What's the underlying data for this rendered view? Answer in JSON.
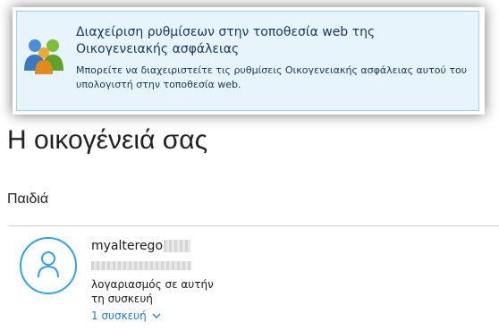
{
  "banner": {
    "title": "Διαχείριση ρυθμίσεων στην τοποθεσία web της Οικογενειακής ασφάλειας",
    "description": "Μπορείτε να διαχειριστείτε τις ρυθμίσεις Οικογενειακής ασφάλειας αυτού του υπολογιστή στην τοποθεσία web.",
    "icon": "family-users-icon"
  },
  "page": {
    "heading": "Η οικογένειά σας",
    "section_heading": "Παιδιά"
  },
  "child": {
    "name": "myalterego",
    "account_note": "λογαριασμός σε αυτήν τη συσκευή",
    "devices_label": "1 συσκευή",
    "avatar_icon": "person-icon"
  },
  "colors": {
    "banner_bg": "#e8f4fb",
    "accent": "#2ea3e5",
    "link": "#1f7ad1"
  }
}
